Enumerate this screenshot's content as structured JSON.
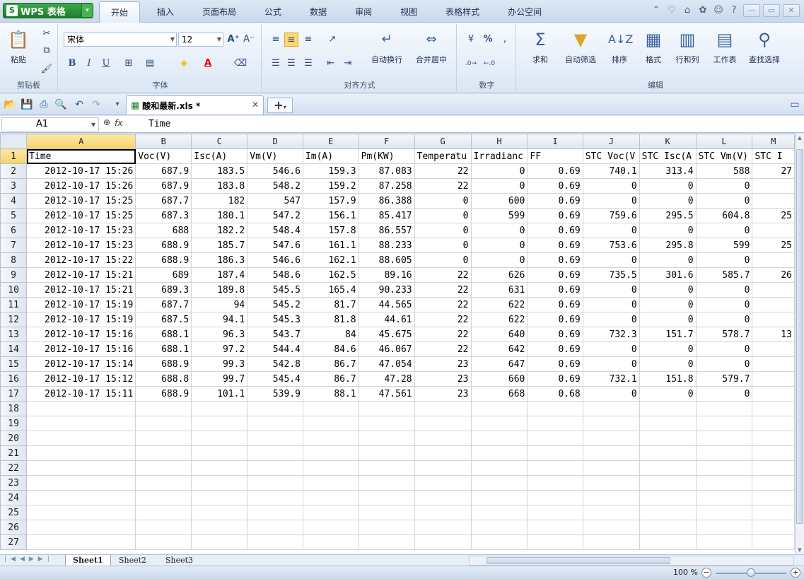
{
  "app": {
    "name": "WPS 表格",
    "logo": "S"
  },
  "menu_tabs": [
    "开始",
    "插入",
    "页面布局",
    "公式",
    "数据",
    "审阅",
    "视图",
    "表格样式",
    "办公空间"
  ],
  "active_tab": "开始",
  "ribbon": {
    "clipboard": {
      "group": "剪贴板",
      "paste": "粘贴"
    },
    "font": {
      "group": "字体",
      "name": "宋体",
      "size": "12",
      "bold": "B",
      "italic": "I",
      "underline": "U"
    },
    "align": {
      "group": "对齐方式",
      "wrap": "自动换行",
      "merge": "合并居中"
    },
    "number": {
      "group": "数字",
      "percent": "%"
    },
    "edit": {
      "group": "编辑",
      "sum": "求和",
      "filter": "自动筛选",
      "sort": "排序",
      "format": "格式",
      "rowcol": "行和列",
      "sheet": "工作表",
      "find": "查找选择"
    }
  },
  "document_tab": "酸和最新.xls *",
  "formula_bar": {
    "cell": "A1",
    "fx": "fx",
    "content": "Time"
  },
  "columns": [
    "A",
    "B",
    "C",
    "D",
    "E",
    "F",
    "G",
    "H",
    "I",
    "J",
    "K",
    "L",
    "M"
  ],
  "headers": [
    "Time",
    "Voc(V)",
    "Isc(A)",
    "Vm(V)",
    "Im(A)",
    "Pm(KW)",
    "Temperatu",
    "Irradianc",
    "FF",
    "STC Voc(V",
    "STC Isc(A",
    "STC Vm(V)",
    "STC I"
  ],
  "rows": [
    [
      "2012-10-17 15:26",
      "687.9",
      "183.5",
      "546.6",
      "159.3",
      "87.083",
      "22",
      "0",
      "0.69",
      "740.1",
      "313.4",
      "588",
      "27"
    ],
    [
      "2012-10-17 15:26",
      "687.9",
      "183.8",
      "548.2",
      "159.2",
      "87.258",
      "22",
      "0",
      "0.69",
      "0",
      "0",
      "0",
      ""
    ],
    [
      "2012-10-17 15:25",
      "687.7",
      "182",
      "547",
      "157.9",
      "86.388",
      "0",
      "600",
      "0.69",
      "0",
      "0",
      "0",
      ""
    ],
    [
      "2012-10-17 15:25",
      "687.3",
      "180.1",
      "547.2",
      "156.1",
      "85.417",
      "0",
      "599",
      "0.69",
      "759.6",
      "295.5",
      "604.8",
      "25"
    ],
    [
      "2012-10-17 15:23",
      "688",
      "182.2",
      "548.4",
      "157.8",
      "86.557",
      "0",
      "0",
      "0.69",
      "0",
      "0",
      "0",
      ""
    ],
    [
      "2012-10-17 15:23",
      "688.9",
      "185.7",
      "547.6",
      "161.1",
      "88.233",
      "0",
      "0",
      "0.69",
      "753.6",
      "295.8",
      "599",
      "25"
    ],
    [
      "2012-10-17 15:22",
      "688.9",
      "186.3",
      "546.6",
      "162.1",
      "88.605",
      "0",
      "0",
      "0.69",
      "0",
      "0",
      "0",
      ""
    ],
    [
      "2012-10-17 15:21",
      "689",
      "187.4",
      "548.6",
      "162.5",
      "89.16",
      "22",
      "626",
      "0.69",
      "735.5",
      "301.6",
      "585.7",
      "26"
    ],
    [
      "2012-10-17 15:21",
      "689.3",
      "189.8",
      "545.5",
      "165.4",
      "90.233",
      "22",
      "631",
      "0.69",
      "0",
      "0",
      "0",
      ""
    ],
    [
      "2012-10-17 15:19",
      "687.7",
      "94",
      "545.2",
      "81.7",
      "44.565",
      "22",
      "622",
      "0.69",
      "0",
      "0",
      "0",
      ""
    ],
    [
      "2012-10-17 15:19",
      "687.5",
      "94.1",
      "545.3",
      "81.8",
      "44.61",
      "22",
      "622",
      "0.69",
      "0",
      "0",
      "0",
      ""
    ],
    [
      "2012-10-17 15:16",
      "688.1",
      "96.3",
      "543.7",
      "84",
      "45.675",
      "22",
      "640",
      "0.69",
      "732.3",
      "151.7",
      "578.7",
      "13"
    ],
    [
      "2012-10-17 15:16",
      "688.1",
      "97.2",
      "544.4",
      "84.6",
      "46.067",
      "22",
      "642",
      "0.69",
      "0",
      "0",
      "0",
      ""
    ],
    [
      "2012-10-17 15:14",
      "688.9",
      "99.3",
      "542.8",
      "86.7",
      "47.054",
      "23",
      "647",
      "0.69",
      "0",
      "0",
      "0",
      ""
    ],
    [
      "2012-10-17 15:12",
      "688.8",
      "99.7",
      "545.4",
      "86.7",
      "47.28",
      "23",
      "660",
      "0.69",
      "732.1",
      "151.8",
      "579.7",
      ""
    ],
    [
      "2012-10-17 15:11",
      "688.9",
      "101.1",
      "539.9",
      "88.1",
      "47.561",
      "23",
      "668",
      "0.68",
      "0",
      "0",
      "0",
      ""
    ]
  ],
  "empty_rows": 10,
  "sheets": [
    "Sheet1",
    "Sheet2",
    "Sheet3"
  ],
  "active_sheet": "Sheet1",
  "zoom": "100 %"
}
